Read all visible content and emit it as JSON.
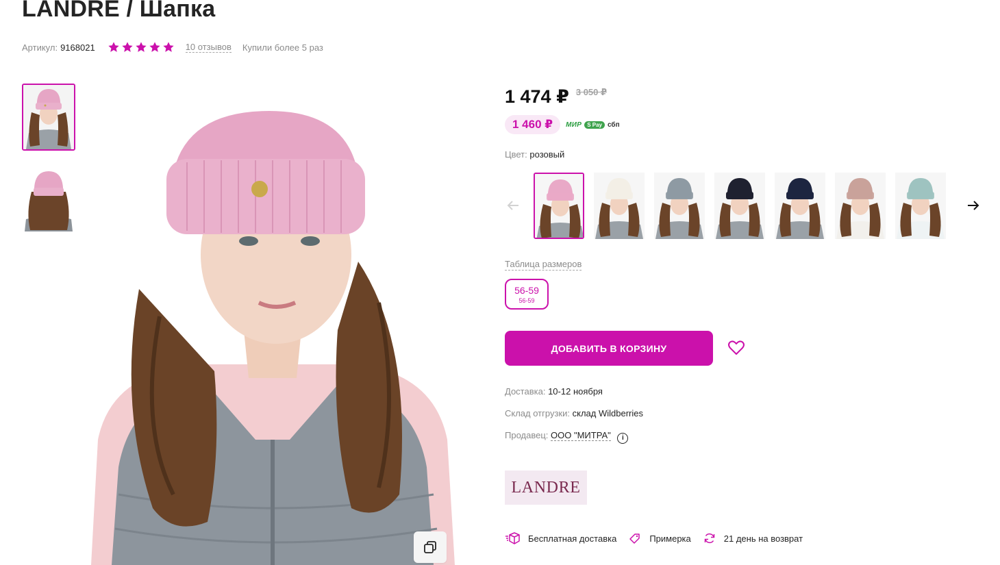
{
  "product": {
    "title": "LANDRE / Шапка",
    "article_label": "Артикул:",
    "article": "9168021",
    "rating": 5,
    "reviews": "10 отзывов",
    "bought": "Купили более 5 раз"
  },
  "price": {
    "current": "1 474 ₽",
    "old": "3 050 ₽",
    "card": "1 460 ₽",
    "pay": {
      "mir": "МИР",
      "spay": "S Pay",
      "sbp": "сбп"
    }
  },
  "color": {
    "label": "Цвет:",
    "value": "розовый",
    "options": [
      {
        "name": "pink",
        "hat": "#e9a9c7",
        "active": true
      },
      {
        "name": "cream",
        "hat": "#f3efe6",
        "active": false
      },
      {
        "name": "grey",
        "hat": "#8e9aa3",
        "active": false
      },
      {
        "name": "black",
        "hat": "#1f2130",
        "active": false
      },
      {
        "name": "navy",
        "hat": "#1d2540",
        "active": false
      },
      {
        "name": "beige",
        "hat": "#c9a29a",
        "active": false
      },
      {
        "name": "mint",
        "hat": "#9ec3c0",
        "active": false
      }
    ]
  },
  "sizes": {
    "table_label": "Таблица размеров",
    "selected": "56-59",
    "selected_sub": "56-59"
  },
  "actions": {
    "add_to_cart": "ДОБАВИТЬ В КОРЗИНУ"
  },
  "delivery": {
    "delivery_label": "Доставка:",
    "delivery_value": "10-12 ноября",
    "warehouse_label": "Склад отгрузки:",
    "warehouse_value": "склад Wildberries",
    "seller_label": "Продавец:",
    "seller_value": "ООО \"МИТРА\""
  },
  "brand": {
    "logo_text": "LANDRE"
  },
  "features": {
    "free_delivery": "Бесплатная доставка",
    "fitting": "Примерка",
    "return": "21 день на возврат"
  },
  "colors": {
    "accent": "#cb11ab",
    "star": "#cb11ab"
  }
}
